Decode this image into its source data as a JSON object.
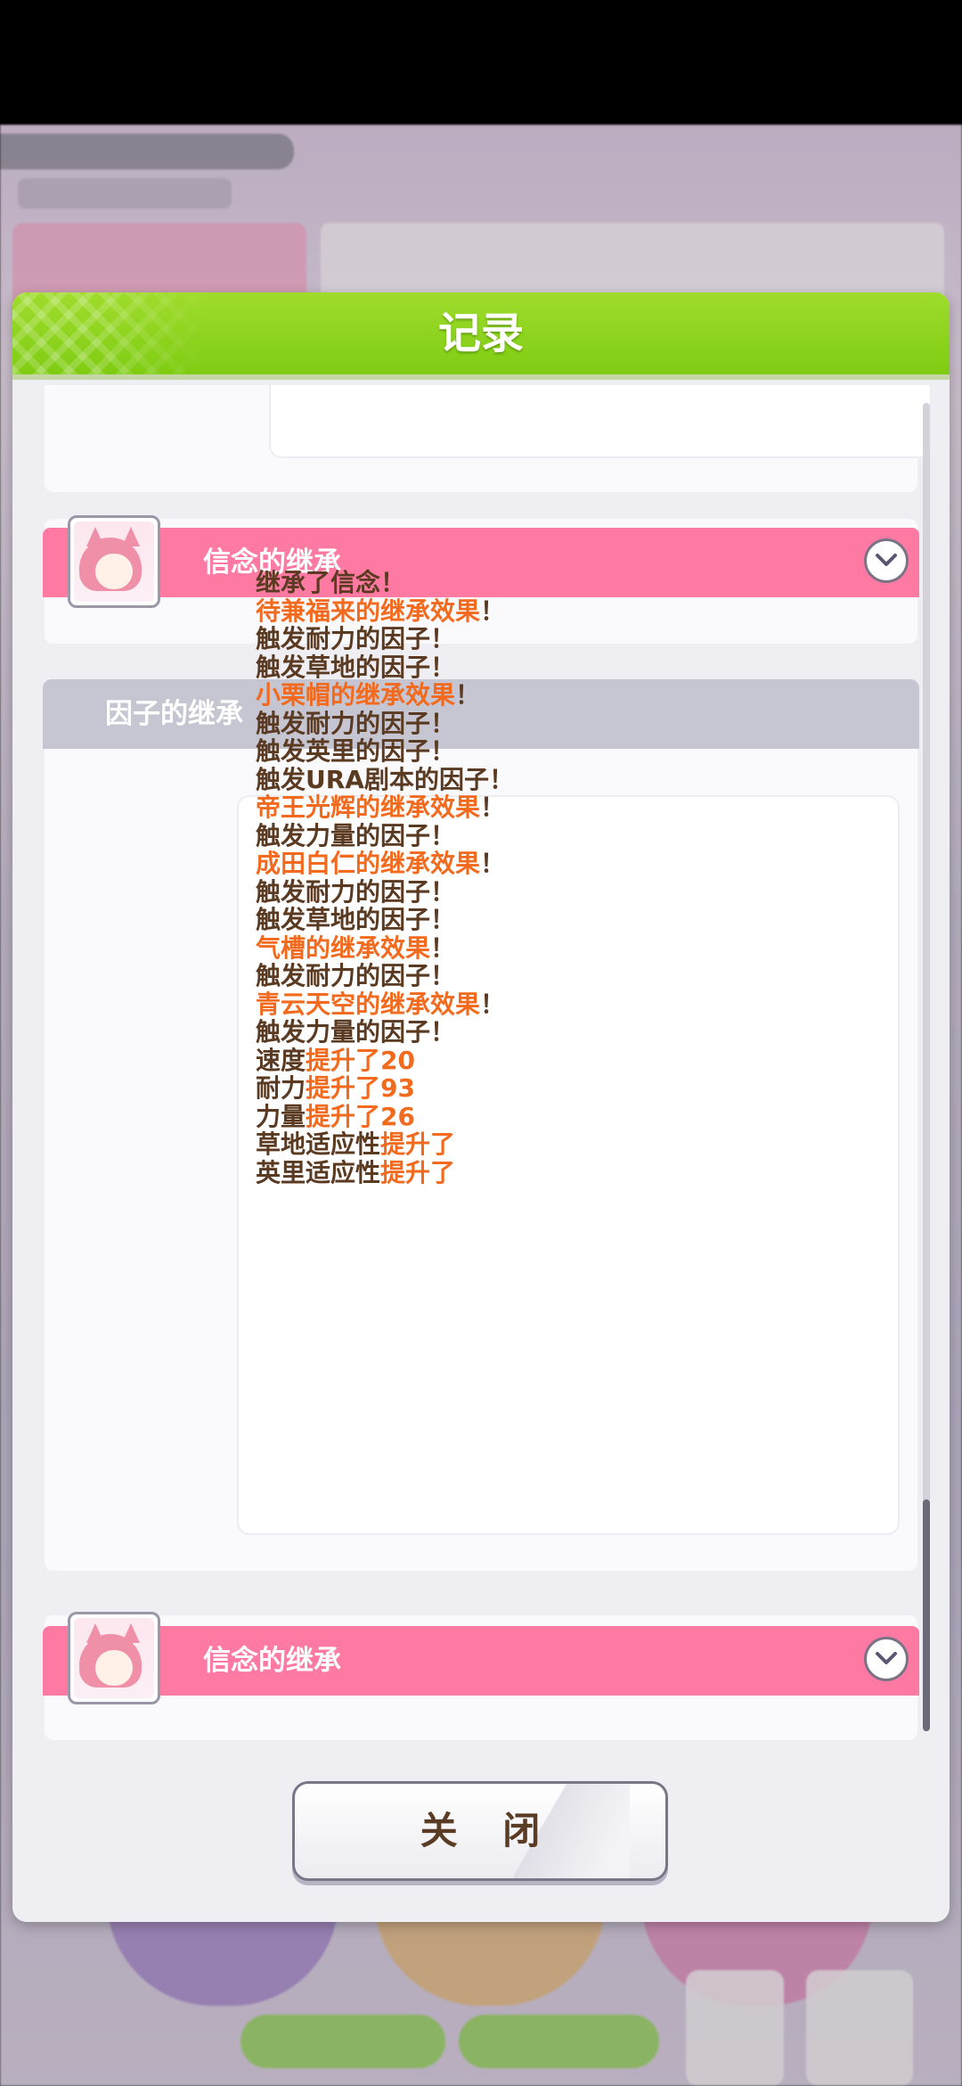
{
  "dialog": {
    "title": "记录",
    "close_label": "关 闭"
  },
  "sections": {
    "belief_1": {
      "label": "信念的继承"
    },
    "factor": {
      "label": "因子的继承",
      "log": [
        [
          {
            "t": "继承了信念！",
            "hl": false
          }
        ],
        [
          {
            "t": "待兼福来的继承效果",
            "hl": true
          },
          {
            "t": "！",
            "hl": false
          }
        ],
        [
          {
            "t": "触发耐力的因子！",
            "hl": false
          }
        ],
        [
          {
            "t": "触发草地的因子！",
            "hl": false
          }
        ],
        [
          {
            "t": "小栗帽的继承效果",
            "hl": true
          },
          {
            "t": "！",
            "hl": false
          }
        ],
        [
          {
            "t": "触发耐力的因子！",
            "hl": false
          }
        ],
        [
          {
            "t": "触发英里的因子！",
            "hl": false
          }
        ],
        [
          {
            "t": "触发URA剧本的因子！",
            "hl": false
          }
        ],
        [
          {
            "t": "帝王光辉的继承效果",
            "hl": true
          },
          {
            "t": "！",
            "hl": false
          }
        ],
        [
          {
            "t": "触发力量的因子！",
            "hl": false
          }
        ],
        [
          {
            "t": "成田白仁的继承效果",
            "hl": true
          },
          {
            "t": "！",
            "hl": false
          }
        ],
        [
          {
            "t": "触发耐力的因子！",
            "hl": false
          }
        ],
        [
          {
            "t": "触发草地的因子！",
            "hl": false
          }
        ],
        [
          {
            "t": "气槽的继承效果",
            "hl": true
          },
          {
            "t": "！",
            "hl": false
          }
        ],
        [
          {
            "t": "触发耐力的因子！",
            "hl": false
          }
        ],
        [
          {
            "t": "青云天空的继承效果",
            "hl": true
          },
          {
            "t": "！",
            "hl": false
          }
        ],
        [
          {
            "t": "触发力量的因子！",
            "hl": false
          }
        ],
        [
          {
            "t": "速度",
            "hl": false
          },
          {
            "t": "提升了20",
            "hl": true
          }
        ],
        [
          {
            "t": "耐力",
            "hl": false
          },
          {
            "t": "提升了93",
            "hl": true
          }
        ],
        [
          {
            "t": "力量",
            "hl": false
          },
          {
            "t": "提升了26",
            "hl": true
          }
        ],
        [
          {
            "t": "草地适应性",
            "hl": false
          },
          {
            "t": "提升了",
            "hl": true
          }
        ],
        [
          {
            "t": "英里适应性",
            "hl": false
          },
          {
            "t": "提升了",
            "hl": true
          }
        ]
      ]
    },
    "belief_2": {
      "label": "信念的继承"
    }
  },
  "colors": {
    "header_green": "#8ad41e",
    "pink_bar": "#ff7aa3",
    "gray_bar": "#c6c5d2",
    "text_brown": "#5b3a22",
    "highlight_orange": "#f26a1e"
  },
  "icons": {
    "expand": "chevron-down-icon",
    "portrait": "character-portrait-icon"
  }
}
